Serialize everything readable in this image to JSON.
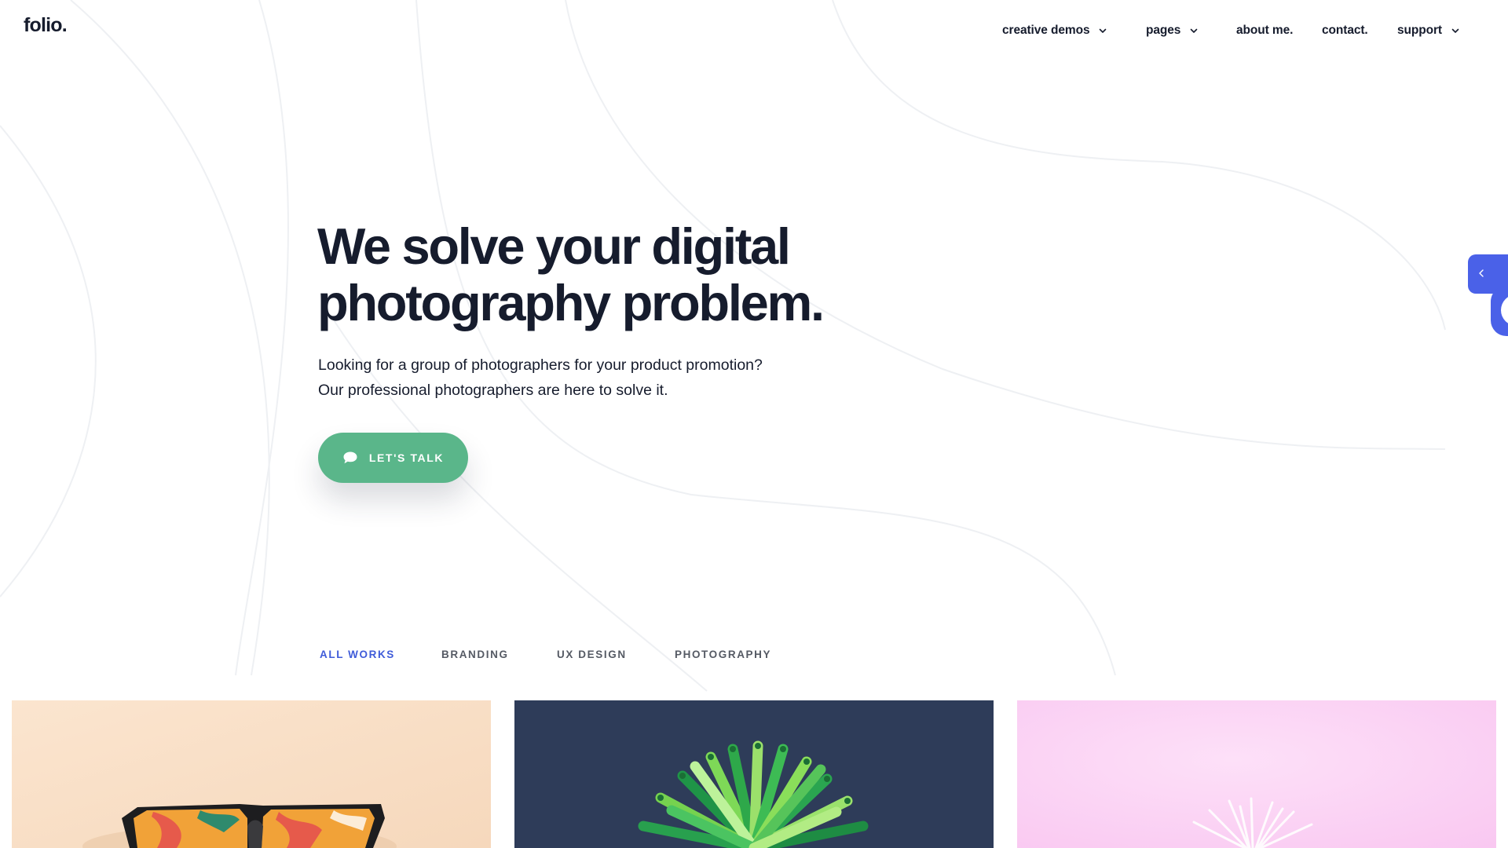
{
  "brand": {
    "logo_text": "folio."
  },
  "nav": {
    "items": [
      {
        "label": "creative demos",
        "has_dropdown": true
      },
      {
        "label": "pages",
        "has_dropdown": true
      },
      {
        "label": "about me.",
        "has_dropdown": false
      },
      {
        "label": "contact.",
        "has_dropdown": false
      },
      {
        "label": "support",
        "has_dropdown": true
      }
    ]
  },
  "hero": {
    "title_line1": "We solve your digital",
    "title_line2": "photography problem.",
    "subtitle_line1": "Looking for a group of photographers for your product promotion?",
    "subtitle_line2": "Our professional photographers are here to solve it.",
    "cta_label": "LET'S TALK",
    "cta_icon": "chat-bubble-icon"
  },
  "side_widget": {
    "icon": "chevron-left-icon"
  },
  "filters": {
    "items": [
      "ALL WORKS",
      "BRANDING",
      "UX DESIGN",
      "PHOTOGRAPHY"
    ],
    "active": "ALL WORKS"
  },
  "portfolio": {
    "cards": [
      {
        "subject": "colorful sunglasses",
        "background": "#f9dfc7"
      },
      {
        "subject": "green straws",
        "background": "#2e3c59"
      },
      {
        "subject": "pink plant",
        "background": "#fcd4f6"
      }
    ]
  },
  "colors": {
    "text": "#161c2d",
    "accent_green": "#5ab68a",
    "accent_blue": "#3f5bd9",
    "side_widget": "#4a61e8",
    "filter_inactive": "#555a64"
  }
}
